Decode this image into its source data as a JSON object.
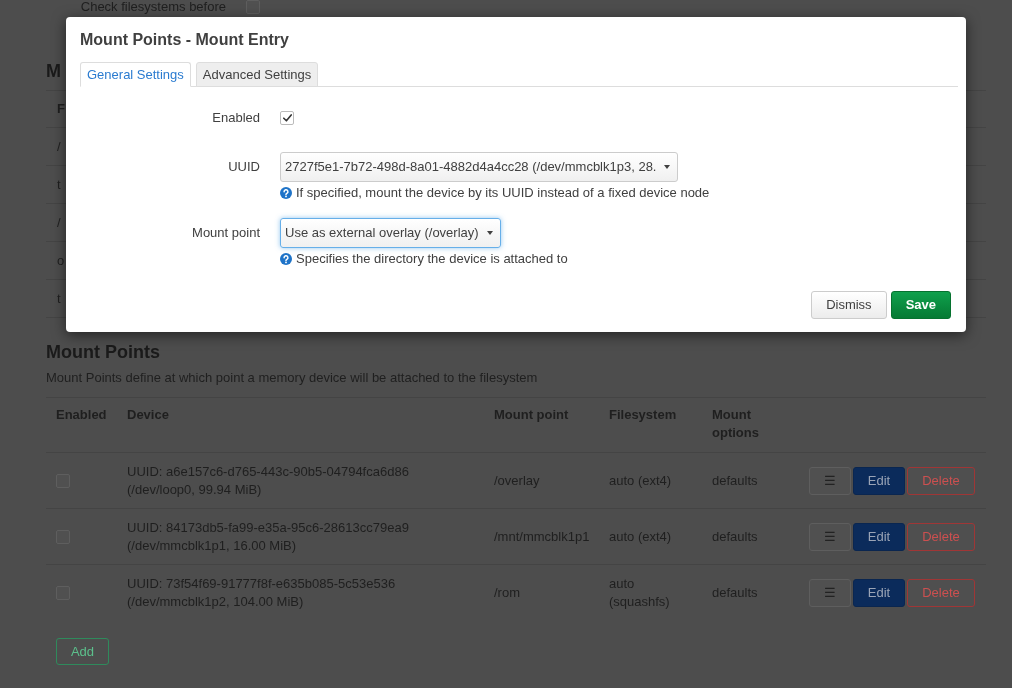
{
  "page": {
    "filesystem_check": {
      "label": "Check filesystems before",
      "checked": false
    },
    "partial_heading": "M",
    "partial_table": {
      "header": "F",
      "rows": [
        "/",
        "t",
        "/",
        "o",
        "t"
      ]
    }
  },
  "mount_points": {
    "title": "Mount Points",
    "description": "Mount Points define at which point a memory device will be attached to the filesystem",
    "columns": [
      "Enabled",
      "Device",
      "Mount point",
      "Filesystem",
      "Mount options"
    ],
    "rows": [
      {
        "enabled": false,
        "device": "UUID: a6e157c6-d765-443c-90b5-04794fca6d86 (/dev/loop0, 99.94 MiB)",
        "mount_point": "/overlay",
        "filesystem": "auto (ext4)",
        "options": "defaults",
        "actions": {
          "menu": "☰",
          "edit": "Edit",
          "delete": "Delete"
        }
      },
      {
        "enabled": false,
        "device": "UUID: 84173db5-fa99-e35a-95c6-28613cc79ea9 (/dev/mmcblk1p1, 16.00 MiB)",
        "mount_point": "/mnt/mmcblk1p1",
        "filesystem": "auto (ext4)",
        "options": "defaults",
        "actions": {
          "menu": "☰",
          "edit": "Edit",
          "delete": "Delete"
        }
      },
      {
        "enabled": false,
        "device": "UUID: 73f54f69-91777f8f-e635b085-5c53e536 (/dev/mmcblk1p2, 104.00 MiB)",
        "mount_point": "/rom",
        "filesystem": "auto (squashfs)",
        "options": "defaults",
        "actions": {
          "menu": "☰",
          "edit": "Edit",
          "delete": "Delete"
        }
      }
    ],
    "add_button": "Add"
  },
  "dialog": {
    "title": "Mount Points - Mount Entry",
    "tabs": [
      {
        "label": "General Settings",
        "selected": true
      },
      {
        "label": "Advanced Settings",
        "selected": false
      }
    ],
    "fields": [
      {
        "kind": "checkbox",
        "label": "Enabled",
        "checked": true
      },
      {
        "kind": "select",
        "label": "UUID",
        "value": "2727f5e1-7b72-498d-8a01-4882d4a4cc28 (/dev/mmcblk1p3, 28.",
        "focused": false,
        "help": "If specified, mount the device by its UUID instead of a fixed device node"
      },
      {
        "kind": "select",
        "label": "Mount point",
        "value": "Use as external overlay (/overlay)",
        "focused": true,
        "help": "Specifies the directory the device is attached to"
      }
    ],
    "buttons": [
      {
        "label": "Dismiss",
        "kind": "secondary"
      },
      {
        "label": "Save",
        "kind": "primary"
      }
    ]
  }
}
